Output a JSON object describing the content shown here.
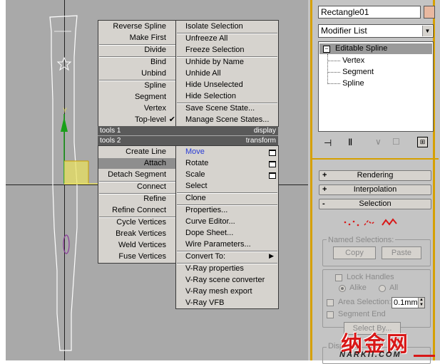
{
  "right_panel": {
    "object_name": "Rectangle01",
    "accent_color": "#e8b8a0",
    "modifier_list_label": "Modifier List",
    "stack": {
      "root": "Editable Spline",
      "children": [
        "Vertex",
        "Segment",
        "Spline"
      ]
    },
    "rollouts": [
      {
        "sign": "+",
        "label": "Rendering"
      },
      {
        "sign": "+",
        "label": "Interpolation"
      },
      {
        "sign": "-",
        "label": "Selection"
      }
    ],
    "named_selections": {
      "legend": "Named Selections:",
      "copy": "Copy",
      "paste": "Paste"
    },
    "lock_handles": "Lock Handles",
    "alike": "Alike",
    "all": "All",
    "area_selection": "Area Selection:",
    "area_value": "0.1mm",
    "segment_end": "Segment End",
    "select_by": "Select By...",
    "display_legend": "Disp"
  },
  "quad_menu": {
    "top_left": [
      "Reverse Spline",
      "Make First",
      "Divide",
      "Bind",
      "Unbind",
      "Spline",
      "Segment",
      "Vertex",
      "Top-level"
    ],
    "top_left_checked": "Top-level",
    "top_right": [
      "Isolate Selection",
      "Unfreeze All",
      "Freeze Selection",
      "Unhide by Name",
      "Unhide All",
      "Hide Unselected",
      "Hide Selection",
      "Save Scene State...",
      "Manage Scene States..."
    ],
    "label_tools1": "tools 1",
    "label_display": "display",
    "label_tools2": "tools 2",
    "label_transform": "transform",
    "bottom_left": [
      "Create Line",
      "Attach",
      "Detach Segment",
      "Connect",
      "Refine",
      "Refine Connect",
      "Cycle Vertices",
      "Break Vertices",
      "Weld Vertices",
      "Fuse Vertices"
    ],
    "bottom_right": [
      "Move",
      "Rotate",
      "Scale",
      "Select",
      "Clone",
      "Properties...",
      "Curve Editor...",
      "Dope Sheet...",
      "Wire Parameters...",
      "Convert To:",
      "V-Ray properties",
      "V-Ray scene converter",
      "V-Ray mesh export",
      "V-Ray VFB"
    ]
  },
  "viewport": {
    "gizmo_axis_label": "Y"
  },
  "watermark": {
    "cn": "纳金网",
    "url": "NARKII.COM"
  },
  "colors": {
    "viewport_bg": "#a9a9a9",
    "menu_bg": "#d6d3ce",
    "header_bg": "#5a5a5a",
    "highlight": "#8e8e8e",
    "move_blue": "#2a3cd6",
    "spline_white": "#ffffff",
    "gizmo_green": "#18a018",
    "gizmo_yellow": "#e8e060",
    "watermark_red": "#d81818"
  }
}
